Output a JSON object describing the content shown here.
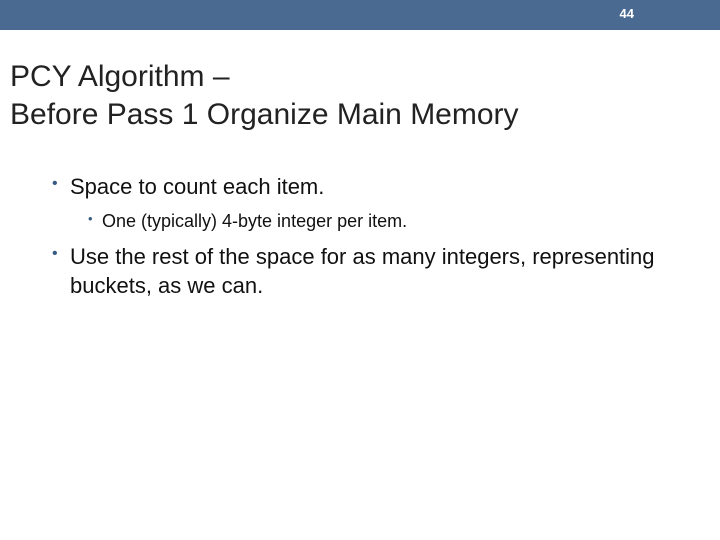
{
  "slide_number": "44",
  "title_line1": "PCY Algorithm –",
  "title_line2": "Before Pass 1 Organize Main Memory",
  "bullets": {
    "b0": "Space to count each item.",
    "b0_sub0": "One (typically) 4-byte integer per item.",
    "b1": "Use the rest of the space for as many integers, representing buckets, as we can."
  }
}
